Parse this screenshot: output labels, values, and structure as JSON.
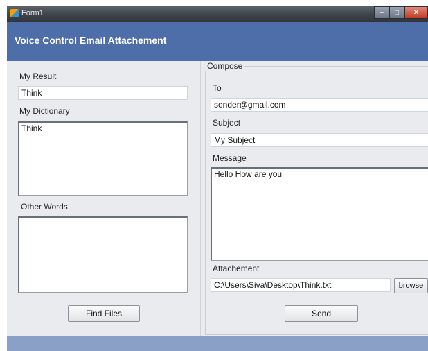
{
  "window": {
    "title": "Form1"
  },
  "header": {
    "title": "Voice Control Email Attachement"
  },
  "left": {
    "result_label": "My Result",
    "result_value": "Think",
    "dictionary_label": "My Dictionary",
    "dictionary_value": "Think",
    "other_words_label": "Other Words",
    "other_words_value": "",
    "find_files_button": "Find Files"
  },
  "compose": {
    "group_label": "Compose",
    "to_label": "To",
    "to_value": "sender@gmail.com",
    "subject_label": "Subject",
    "subject_value": "My Subject",
    "message_label": "Message",
    "message_value": "Hello How are you",
    "attachment_label": "Attachement",
    "attachment_value": "C:\\Users\\Siva\\Desktop\\Think.txt",
    "browse_button": "browse",
    "send_button": "Send"
  },
  "colors": {
    "header": "#4d6ea8",
    "footer": "#8aa0c6",
    "background": "#e9ebef"
  },
  "icons": {
    "app": "app-icon",
    "minimize": "minimize-icon",
    "maximize": "maximize-icon",
    "close": "close-icon"
  }
}
